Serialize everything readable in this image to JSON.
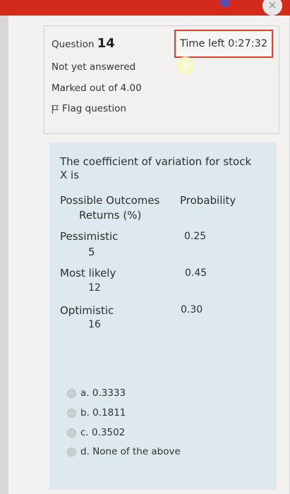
{
  "question": {
    "label": "Question",
    "number": "14",
    "status": "Not yet answered",
    "marks": "Marked out of 4.00",
    "flag_label": "Flag question"
  },
  "timer": {
    "text": "Time left 0:27:32"
  },
  "prompt": {
    "line1": "The coefficient of variation for stock",
    "line2": "X is"
  },
  "table": {
    "header_col1": "Possible Outcomes",
    "header_col2": "Probability",
    "header_sub": "Returns (%)",
    "rows": [
      {
        "outcome": "Pessimistic",
        "return": "5",
        "probability": "0.25"
      },
      {
        "outcome": "Most likely",
        "return": "12",
        "probability": "0.45"
      },
      {
        "outcome": "Optimistic",
        "return": "16",
        "probability": "0.30"
      }
    ]
  },
  "answers": [
    {
      "label": "a. 0.3333"
    },
    {
      "label": "b. 0.1811"
    },
    {
      "label": "c. 0.3502"
    },
    {
      "label": "d. None of the above"
    }
  ],
  "icons": [
    "flag-icon",
    "radio-icon",
    "close-icon"
  ]
}
